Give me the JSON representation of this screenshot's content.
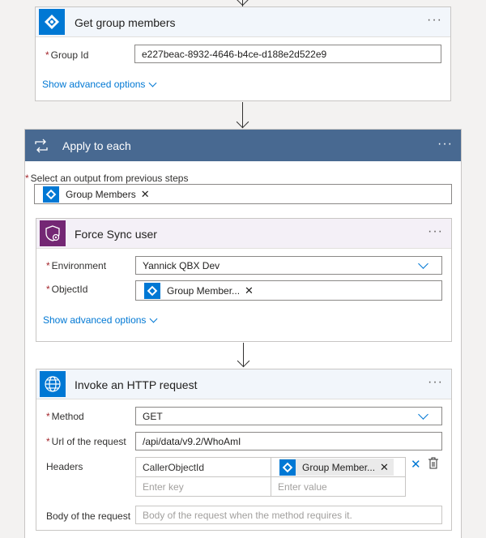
{
  "colors": {
    "accent": "#0078d4",
    "purple": "#742774",
    "loop_header": "#486991",
    "required": "#a4262c"
  },
  "get_group_members": {
    "title": "Get group members",
    "more": "···",
    "group_id_label": "Group Id",
    "group_id_value": "e227beac-8932-4646-b4ce-d188e2d522e9",
    "advanced": "Show advanced options",
    "icon": "azure-ad-icon"
  },
  "apply_to_each": {
    "title": "Apply to each",
    "more": "···",
    "select_label": "Select an output from previous steps",
    "token_label": "Group Members",
    "icon": "loop-icon"
  },
  "force_sync": {
    "title": "Force Sync user",
    "more": "···",
    "environment_label": "Environment",
    "environment_value": "Yannick QBX Dev",
    "objectid_label": "ObjectId",
    "objectid_token": "Group Member...",
    "advanced": "Show advanced options",
    "icon": "shield-gear-icon"
  },
  "http_request": {
    "title": "Invoke an HTTP request",
    "more": "···",
    "method_label": "Method",
    "method_value": "GET",
    "url_label": "Url of the request",
    "url_value": "/api/data/v9.2/WhoAmI",
    "headers_label": "Headers",
    "header_key": "CallerObjectId",
    "header_value_token": "Group Member...",
    "key_placeholder": "Enter key",
    "value_placeholder": "Enter value",
    "body_label": "Body of the request",
    "body_placeholder": "Body of the request when the method requires it.",
    "icon": "globe-icon"
  }
}
